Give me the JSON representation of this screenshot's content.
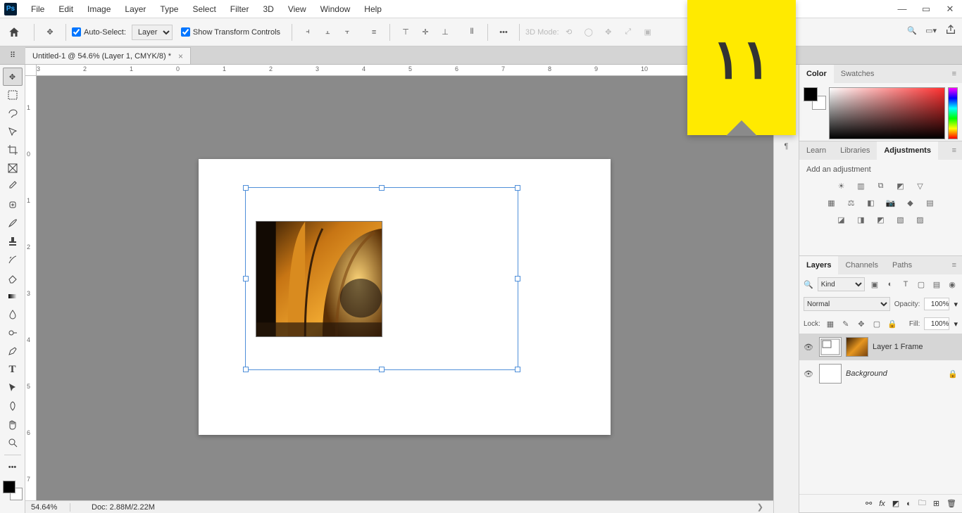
{
  "menu": {
    "items": [
      "File",
      "Edit",
      "Image",
      "Layer",
      "Type",
      "Select",
      "Filter",
      "3D",
      "View",
      "Window",
      "Help"
    ]
  },
  "optbar": {
    "autoSelect": "Auto-Select:",
    "layerDropdown": "Layer",
    "showTransform": "Show Transform Controls",
    "threeDMode": "3D Mode:"
  },
  "tab": {
    "title": "Untitled-1 @ 54.6% (Layer 1, CMYK/8) *"
  },
  "ruler": {
    "h": [
      "3",
      "2",
      "1",
      "0",
      "1",
      "2",
      "3",
      "4",
      "5",
      "6",
      "7",
      "8",
      "9",
      "10"
    ],
    "v": [
      "1",
      "0",
      "1",
      "2",
      "3",
      "4",
      "5",
      "6",
      "7"
    ]
  },
  "status": {
    "zoom": "54.64%",
    "doc": "Doc: 2.88M/2.22M"
  },
  "panels": {
    "color": {
      "tab1": "Color",
      "tab2": "Swatches"
    },
    "adjust": {
      "tab1": "Learn",
      "tab2": "Libraries",
      "tab3": "Adjustments",
      "label": "Add an adjustment"
    },
    "layers": {
      "tab1": "Layers",
      "tab2": "Channels",
      "tab3": "Paths",
      "kind": "Kind",
      "blend": "Normal",
      "opacityLbl": "Opacity:",
      "opacity": "100%",
      "lockLbl": "Lock:",
      "fillLbl": "Fill:",
      "fill": "100%",
      "layer1": "Layer 1 Frame",
      "bg": "Background"
    }
  },
  "sticky": {
    "text": "۱۱"
  }
}
